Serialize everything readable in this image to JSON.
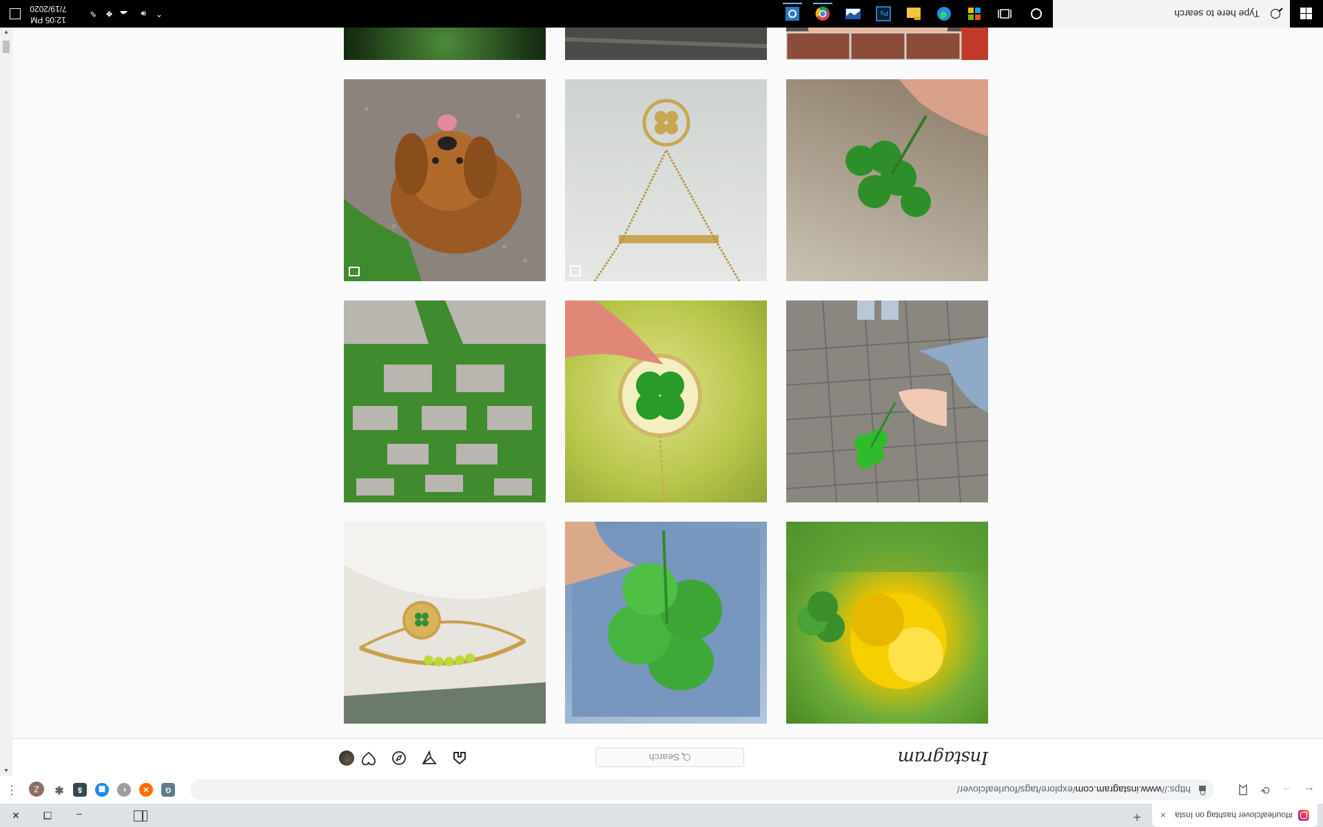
{
  "browser": {
    "tab_title": "#fourleafclover hashtag on Insta",
    "tab_close": "×",
    "new_tab": "+",
    "url_scheme": "https://",
    "url_host": "www.instagram.com",
    "url_path": "/explore/tags/fourleafclover/",
    "back": "←",
    "forward": "→",
    "reload": "⟳",
    "minimize": "–",
    "maximize": "❐",
    "close": "✕",
    "profile_initial": "Z",
    "menu": "⋮"
  },
  "instagram": {
    "logo_text": "Instagram",
    "search_placeholder": "Search"
  },
  "taskbar": {
    "search_placeholder": "Type here to search",
    "time": "12:05 PM",
    "date": "7/19/2020"
  },
  "colors": {
    "ig_border": "#dbdbdb",
    "taskbar": "#000000",
    "page_bg": "#fafafa"
  },
  "posts": [
    {
      "subject": "yellow flower with clover"
    },
    {
      "subject": "four leaf clover held in hand"
    },
    {
      "subject": "lucky charm bracelet"
    },
    {
      "subject": "hand holding clover on pavement"
    },
    {
      "subject": "clover in resin pendant"
    },
    {
      "subject": "grass and stone checkerboard"
    },
    {
      "subject": "clover sprig held in fingers"
    },
    {
      "subject": "clover pendant necklace"
    },
    {
      "subject": "puppy lying in clover"
    },
    {
      "subject": "clover on arm tattoo"
    },
    {
      "subject": "clover on dark ground"
    },
    {
      "subject": "finger with green background"
    }
  ]
}
